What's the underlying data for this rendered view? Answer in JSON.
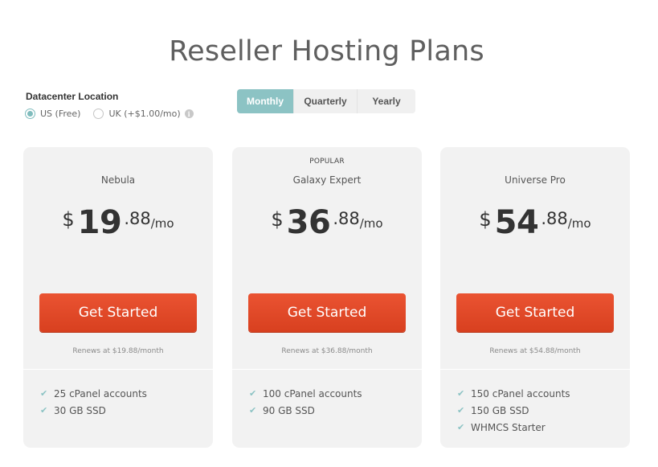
{
  "page": {
    "title": "Reseller Hosting Plans"
  },
  "datacenter": {
    "label": "Datacenter Location",
    "options": [
      {
        "label": "US (Free)",
        "selected": true
      },
      {
        "label": "UK (+$1.00/mo)",
        "selected": false
      }
    ],
    "info_icon": "i"
  },
  "billing": {
    "options": [
      "Monthly",
      "Quarterly",
      "Yearly"
    ],
    "active": "Monthly"
  },
  "colors": {
    "accent": "#8cc3c4",
    "cta": "#e24a2a",
    "card_bg": "#f2f2f2"
  },
  "plans": [
    {
      "badge": "",
      "name": "Nebula",
      "currency": "$",
      "price_whole": "19",
      "price_frac": ".88",
      "period": "/mo",
      "cta": "Get Started",
      "renews": "Renews at $19.88/month",
      "features": [
        "25 cPanel accounts",
        "30 GB SSD"
      ]
    },
    {
      "badge": "POPULAR",
      "name": "Galaxy Expert",
      "currency": "$",
      "price_whole": "36",
      "price_frac": ".88",
      "period": "/mo",
      "cta": "Get Started",
      "renews": "Renews at $36.88/month",
      "features": [
        "100 cPanel accounts",
        "90 GB SSD"
      ]
    },
    {
      "badge": "",
      "name": "Universe Pro",
      "currency": "$",
      "price_whole": "54",
      "price_frac": ".88",
      "period": "/mo",
      "cta": "Get Started",
      "renews": "Renews at $54.88/month",
      "features": [
        "150 cPanel accounts",
        "150 GB SSD",
        "WHMCS Starter"
      ]
    }
  ]
}
